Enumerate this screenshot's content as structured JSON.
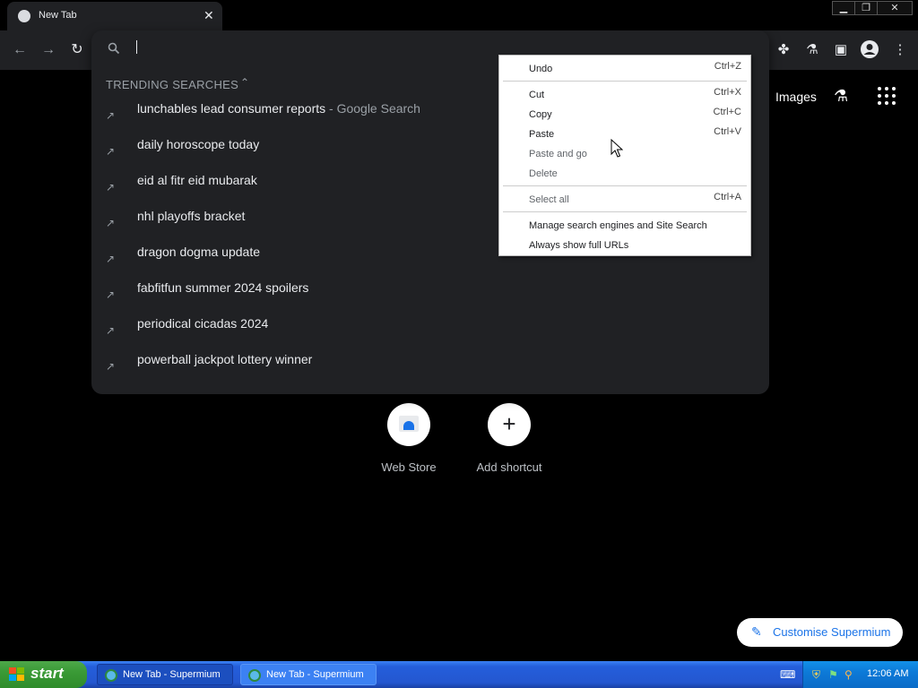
{
  "browser": {
    "tab": {
      "title": "New Tab"
    },
    "window_controls": {
      "minimize": "▁",
      "restore": "❐",
      "close": "✕"
    }
  },
  "omnibox": {
    "query": "",
    "trending_header": "TRENDING SEARCHES",
    "suggestions": [
      {
        "text": "lunchables lead consumer reports",
        "suffix": " - Google Search"
      },
      {
        "text": "daily horoscope today",
        "suffix": ""
      },
      {
        "text": "eid al fitr eid mubarak",
        "suffix": ""
      },
      {
        "text": "nhl playoffs bracket",
        "suffix": ""
      },
      {
        "text": "dragon dogma update",
        "suffix": ""
      },
      {
        "text": "fabfitfun summer 2024 spoilers",
        "suffix": ""
      },
      {
        "text": "periodical cicadas 2024",
        "suffix": ""
      },
      {
        "text": "powerball jackpot lottery winner",
        "suffix": ""
      }
    ]
  },
  "page": {
    "top_links": {
      "images": "Images"
    },
    "shortcuts": [
      {
        "label": "Web Store"
      },
      {
        "label": "Add shortcut"
      }
    ],
    "customise_label": "Customise Supermium"
  },
  "context_menu": {
    "items": [
      {
        "label": "Undo",
        "shortcut": "Ctrl+Z"
      },
      {
        "label": "Cut",
        "shortcut": "Ctrl+X"
      },
      {
        "label": "Copy",
        "shortcut": "Ctrl+C"
      },
      {
        "label": "Paste",
        "shortcut": "Ctrl+V"
      },
      {
        "label": "Paste and go",
        "shortcut": ""
      },
      {
        "label": "Delete",
        "shortcut": ""
      },
      {
        "label": "Select all",
        "shortcut": "Ctrl+A"
      },
      {
        "label": "Manage search engines and Site Search",
        "shortcut": ""
      },
      {
        "label": "Always show full URLs",
        "shortcut": ""
      }
    ]
  },
  "taskbar": {
    "start_label": "start",
    "tasks": [
      {
        "label": "New Tab - Supermium"
      },
      {
        "label": "New Tab - Supermium"
      }
    ],
    "clock": "12:06 AM"
  },
  "colors": {
    "page_bg": "#000000",
    "omnibox_bg": "#202124",
    "accent_blue": "#1a73e8",
    "taskbar_blue": "#245edb",
    "start_green": "#3a9a36"
  }
}
